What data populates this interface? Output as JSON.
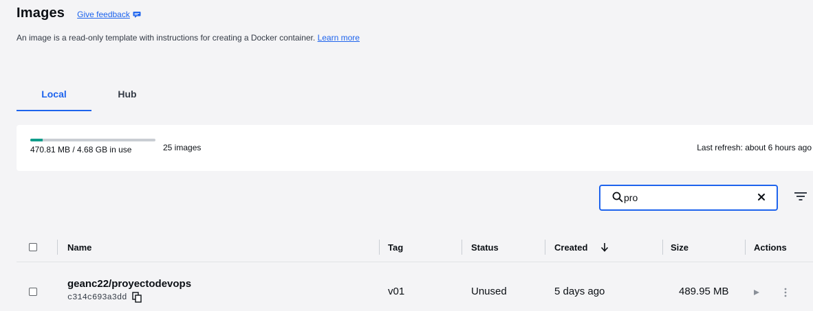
{
  "header": {
    "title": "Images",
    "feedback_label": "Give feedback"
  },
  "description": {
    "text": "An image is a read-only template with instructions for creating a Docker container.",
    "link_label": "Learn more"
  },
  "tabs": [
    {
      "label": "Local",
      "active": true
    },
    {
      "label": "Hub",
      "active": false
    }
  ],
  "usage": {
    "text": "470.81 MB / 4.68 GB in use",
    "used_fraction": 0.098,
    "images_count": "25 images",
    "last_refresh": "Last refresh: about 6 hours ago"
  },
  "search": {
    "value": "pro",
    "placeholder": "Search"
  },
  "table": {
    "columns": {
      "name": "Name",
      "tag": "Tag",
      "status": "Status",
      "created": "Created",
      "size": "Size",
      "actions": "Actions"
    },
    "rows": [
      {
        "name": "geanc22/proyectodevops",
        "id": "c314c693a3dd",
        "tag": "v01",
        "status": "Unused",
        "created": "5 days ago",
        "size": "489.95 MB"
      }
    ]
  },
  "colors": {
    "accent": "#1d63ed",
    "usage_fill": "#0f9d8a",
    "background": "#f4f4f6"
  },
  "icons": [
    "feedback-icon",
    "search-icon",
    "clear-icon",
    "filter-icon",
    "sort-down-arrow-icon",
    "copy-icon",
    "play-icon",
    "more-vert-icon"
  ]
}
